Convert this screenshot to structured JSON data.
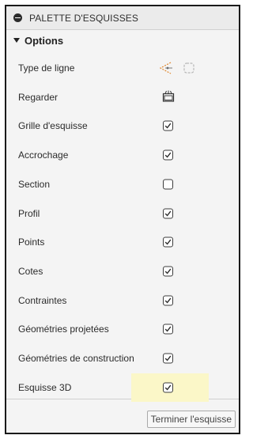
{
  "palette": {
    "title": "PALETTE D'ESQUISSES",
    "section_label": "Options",
    "colors": {
      "panel_bg": "#f4f4f4",
      "highlight": "#fbf7c8",
      "linetype_icon": "#e0882e"
    },
    "rows": [
      {
        "label": "Type de ligne",
        "control": "linetype-icons"
      },
      {
        "label": "Regarder",
        "control": "look-icon"
      },
      {
        "label": "Grille d'esquisse",
        "control": "checkbox",
        "checked": true
      },
      {
        "label": "Accrochage",
        "control": "checkbox",
        "checked": true
      },
      {
        "label": "Section",
        "control": "checkbox",
        "checked": false
      },
      {
        "label": "Profil",
        "control": "checkbox",
        "checked": true
      },
      {
        "label": "Points",
        "control": "checkbox",
        "checked": true
      },
      {
        "label": "Cotes",
        "control": "checkbox",
        "checked": true
      },
      {
        "label": "Contraintes",
        "control": "checkbox",
        "checked": true
      },
      {
        "label": "Géométries projetées",
        "control": "checkbox",
        "checked": true
      },
      {
        "label": "Géométries de construction",
        "control": "checkbox",
        "checked": true
      },
      {
        "label": "Esquisse 3D",
        "control": "checkbox",
        "checked": true,
        "highlighted": true
      }
    ],
    "finish_button_label": "Terminer l'esquisse"
  }
}
